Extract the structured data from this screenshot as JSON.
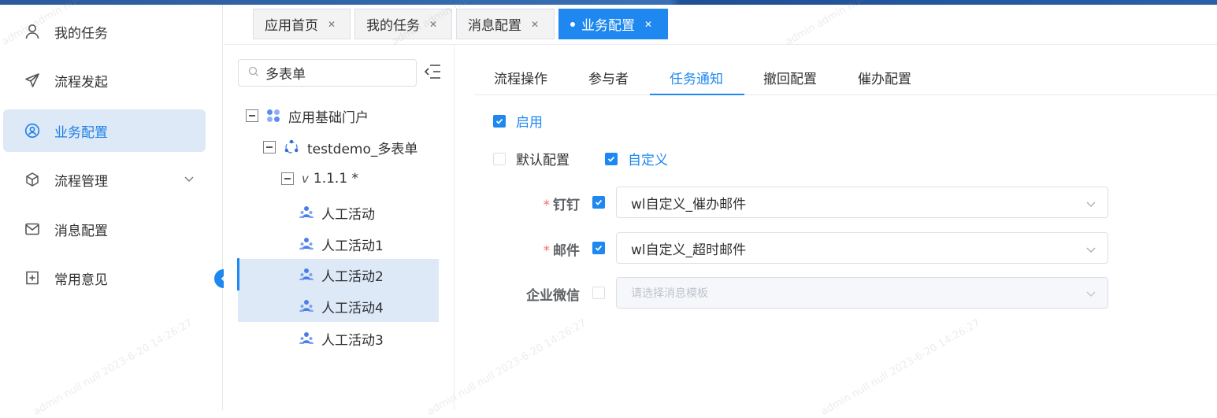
{
  "sidebar": {
    "items": [
      {
        "label": "我的任务",
        "icon": "user-icon"
      },
      {
        "label": "流程发起",
        "icon": "paper-plane-icon"
      },
      {
        "label": "业务配置",
        "icon": "user-circle-icon"
      },
      {
        "label": "流程管理",
        "icon": "cube-icon"
      },
      {
        "label": "消息配置",
        "icon": "mail-icon"
      },
      {
        "label": "常用意见",
        "icon": "plus-square-icon"
      }
    ]
  },
  "tabs": [
    {
      "label": "应用首页"
    },
    {
      "label": "我的任务"
    },
    {
      "label": "消息配置"
    },
    {
      "label": "业务配置"
    }
  ],
  "tree": {
    "search_value": "多表单",
    "nodes": {
      "root": "应用基础门户",
      "app": "testdemo_多表单",
      "version_prefix": "v",
      "version": "1.1.1 *",
      "leaf1": "人工活动",
      "leaf2": "人工活动1",
      "leaf3": "人工活动2",
      "leaf4": "人工活动4",
      "leaf5": "人工活动3"
    }
  },
  "subtabs": [
    {
      "label": "流程操作"
    },
    {
      "label": "参与者"
    },
    {
      "label": "任务通知"
    },
    {
      "label": "撤回配置"
    },
    {
      "label": "催办配置"
    }
  ],
  "form": {
    "enable_label": "启用",
    "default_label": "默认配置",
    "custom_label": "自定义",
    "dingtalk_label": "钉钉",
    "dingtalk_value": "wl自定义_催办邮件",
    "email_label": "邮件",
    "email_value": "wl自定义_超时邮件",
    "wecom_label": "企业微信",
    "wecom_placeholder": "请选择消息模板",
    "required_mark": "*"
  },
  "watermark": {
    "text1": "admin admin null",
    "text2": "admin null null 2023-6-20 14:26:27"
  },
  "colors": {
    "accent": "#1e88f0",
    "active_bg": "#dde9f7",
    "required": "#f56c6c"
  }
}
